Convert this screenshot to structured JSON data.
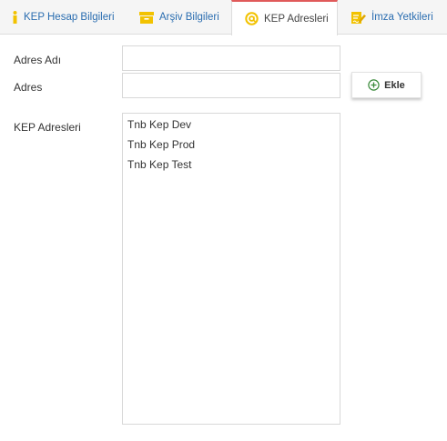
{
  "tabs": [
    {
      "label": "KEP Hesap Bilgileri",
      "icon": "info-icon",
      "active": false
    },
    {
      "label": "Arşiv Bilgileri",
      "icon": "archive-box-icon",
      "active": false
    },
    {
      "label": "KEP Adresleri",
      "icon": "at-sign-icon",
      "active": true
    },
    {
      "label": "İmza Yetkileri",
      "icon": "signature-edit-icon",
      "active": false
    }
  ],
  "form": {
    "address_name_label": "Adres Adı",
    "address_name_value": "",
    "address_label": "Adres",
    "address_value": "",
    "add_button_label": "Ekle",
    "kep_addresses_label": "KEP Adresleri"
  },
  "kep_addresses": [
    "Tnb Kep Dev",
    "Tnb Kep Prod",
    "Tnb Kep Test"
  ],
  "colors": {
    "tab_text": "#2a6db0",
    "icon_yellow": "#f2c200",
    "active_tab_border": "#e05a5a",
    "add_icon_green": "#3a8a3a"
  }
}
